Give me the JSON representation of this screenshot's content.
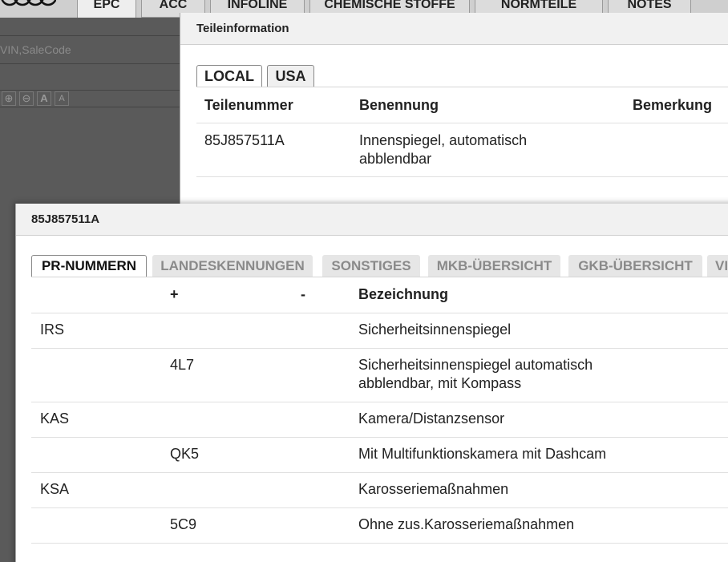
{
  "background_app": {
    "tabs": [
      {
        "label": "EPC",
        "active": true
      },
      {
        "label": "ACC"
      },
      {
        "label": "INFOLINE"
      },
      {
        "label": "CHEMISCHE STOFFE"
      },
      {
        "label": "NORMTEILE"
      },
      {
        "label": "NOTES"
      }
    ],
    "search_placeholder": "VIN,SaleCode",
    "toolbar_icons": [
      "zoom-in-icon",
      "zoom-out-icon",
      "font-increase-icon",
      "font-decrease-icon"
    ]
  },
  "parts_dialog": {
    "title": "Teileinformation",
    "tabs": [
      "LOCAL",
      "USA"
    ],
    "columns": [
      "Teilenummer",
      "Benennung",
      "Bemerkung"
    ],
    "rows": [
      {
        "teilenummer": "85J857511A",
        "benennung_line1": "Innenspiegel, automatisch",
        "benennung_line2": "abblendbar",
        "bemerkung": ""
      }
    ]
  },
  "pr_dialog": {
    "title": "85J857511A",
    "tabs": [
      "PR-NUMMERN",
      "LANDESKENNUNGEN",
      "SONSTIGES",
      "MKB-ÜBERSICHT",
      "GKB-ÜBERSICHT",
      "VI"
    ],
    "active_tab": "PR-NUMMERN",
    "columns": {
      "family": "",
      "plus": "+",
      "minus": "-",
      "desc": "Bezeichnung"
    },
    "rows": [
      {
        "family": "IRS",
        "plus": "",
        "desc1": "Sicherheitsinnenspiegel",
        "desc2": ""
      },
      {
        "family": "",
        "plus": "4L7",
        "desc1": "Sicherheitsinnenspiegel automatisch",
        "desc2": "abblendbar, mit Kompass"
      },
      {
        "family": "KAS",
        "plus": "",
        "desc1": "Kamera/Distanzsensor",
        "desc2": ""
      },
      {
        "family": "",
        "plus": "QK5",
        "desc1": "Mit Multifunktionskamera mit Dashcam",
        "desc2": ""
      },
      {
        "family": "KSA",
        "plus": "",
        "desc1": "Karosseriemaßnahmen",
        "desc2": ""
      },
      {
        "family": "",
        "plus": "5C9",
        "desc1": "Ohne zus.Karosseriemaßnahmen",
        "desc2": ""
      }
    ]
  }
}
